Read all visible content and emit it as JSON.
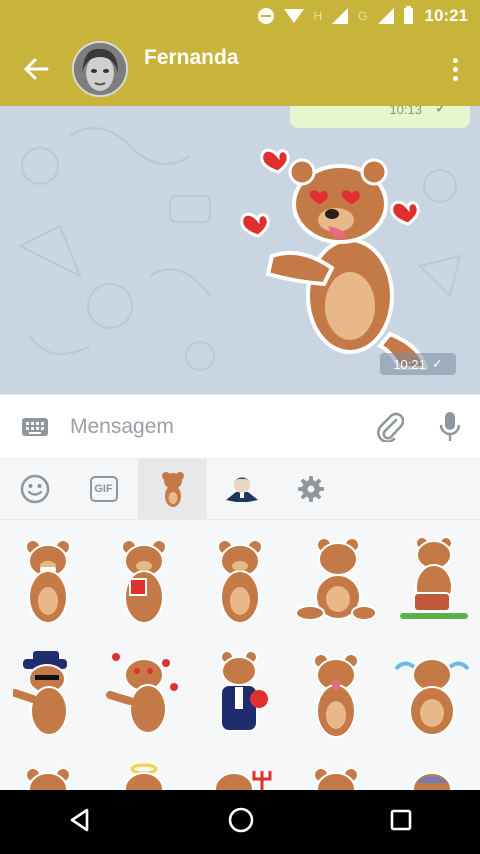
{
  "status_bar": {
    "time": "10:21",
    "net_labels": [
      "H",
      "G"
    ]
  },
  "toolbar": {
    "contact_name": "Fernanda"
  },
  "chat": {
    "previous_message_time": "10:13",
    "sticker_time": "10:21",
    "check": "✓"
  },
  "input": {
    "placeholder": "Mensagem"
  },
  "sticker_tabs": [
    {
      "name": "emoji-tab",
      "label": ""
    },
    {
      "name": "gif-tab",
      "label": "GIF"
    },
    {
      "name": "bear-pack-tab",
      "label": ""
    },
    {
      "name": "man-pack-tab",
      "label": ""
    },
    {
      "name": "settings-tab",
      "label": ""
    }
  ],
  "colors": {
    "toolbar": "#c8b43a",
    "chat_bg": "#c9d6e1",
    "bear": "#c47a47"
  }
}
